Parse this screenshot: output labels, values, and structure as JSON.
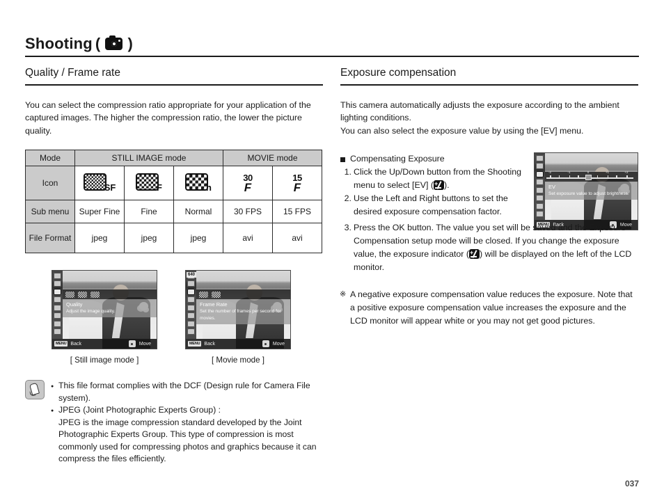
{
  "header": {
    "title": "Shooting",
    "paren_open": "(",
    "paren_close": ")",
    "camera_icon": "camera-icon"
  },
  "left": {
    "section_title": "Quality / Frame rate",
    "intro": "You can select the compression ratio appropriate for your application of the captured images. The higher the compression ratio, the lower the picture quality.",
    "table": {
      "row_labels": [
        "Mode",
        "Icon",
        "Sub menu",
        "File Format"
      ],
      "group_headers": [
        {
          "label": "Mode",
          "span": 1
        },
        {
          "label": "STILL IMAGE mode",
          "span": 3
        },
        {
          "label": "MOVIE mode",
          "span": 2
        }
      ],
      "icons": [
        {
          "type": "checker",
          "density": "fine",
          "sub": "SF"
        },
        {
          "type": "checker",
          "density": "mid",
          "sub": "F"
        },
        {
          "type": "checker",
          "density": "coarse",
          "sub": "n"
        },
        {
          "type": "fps",
          "num": "30",
          "f": "F"
        },
        {
          "type": "fps",
          "num": "15",
          "f": "F"
        }
      ],
      "sub_menu": [
        "Super Fine",
        "Fine",
        "Normal",
        "30 FPS",
        "15 FPS"
      ],
      "file_format": [
        "jpeg",
        "jpeg",
        "jpeg",
        "avi",
        "avi"
      ]
    },
    "screens": [
      {
        "menu_title": "Quality",
        "menu_desc": "Adjust the image quality.",
        "back_key": "MENU",
        "back_label": "Back",
        "move_label": "Move",
        "caption": "[ Still image mode ]"
      },
      {
        "badge": "640",
        "menu_title": "Frame Rate",
        "menu_desc": "Set the number of frames per second for movies.",
        "back_key": "MENU",
        "back_label": "Back",
        "move_label": "Move",
        "caption": "[ Movie mode ]"
      }
    ],
    "note": {
      "items": [
        "This file format complies with the DCF (Design rule for Camera File system).",
        "JPEG (Joint Photographic Experts Group) :"
      ],
      "continuation": "JPEG is the image compression standard developed by the Joint Photographic Experts Group. This type of compression is most commonly used for compressing photos and graphics because it can compress the files efficiently."
    }
  },
  "right": {
    "section_title": "Exposure compensation",
    "intro_line1": "This camera automatically adjusts the exposure according to the ambient lighting conditions.",
    "intro_line2": "You can also select the exposure value by using the [EV] menu.",
    "sub_head": "Compensating Exposure",
    "steps": [
      {
        "num": "1.",
        "text_before": "Click the Up/Down button from the Shooting menu to select [EV] (",
        "icon": "ev-icon",
        "text_after": ")."
      },
      {
        "num": "2.",
        "text_before": "Use the Left and Right buttons to set the desired exposure compensation factor.",
        "icon": "",
        "text_after": ""
      },
      {
        "num": "3.",
        "text_before": "Press the OK button. The value you set will be saved and the Exposure Compensation setup mode will be closed. If you change the exposure value, the exposure indicator (",
        "icon": "ev-icon",
        "text_after": ") will be displayed on the left of the LCD monitor."
      }
    ],
    "screen": {
      "menu_title": "EV",
      "menu_desc": "Set exposure value to adjust brightness.",
      "back_key": "MENU",
      "back_label": "Back",
      "move_label": "Move",
      "scale_labels": [
        "-2",
        "-1",
        "0",
        "+1",
        "+2"
      ]
    },
    "star_symbol": "※",
    "star_note": "A negative exposure compensation value reduces the exposure. Note that a positive exposure compensation value increases the exposure and the LCD monitor will appear white or you may not get good pictures."
  },
  "footer": {
    "page_number": "037"
  }
}
